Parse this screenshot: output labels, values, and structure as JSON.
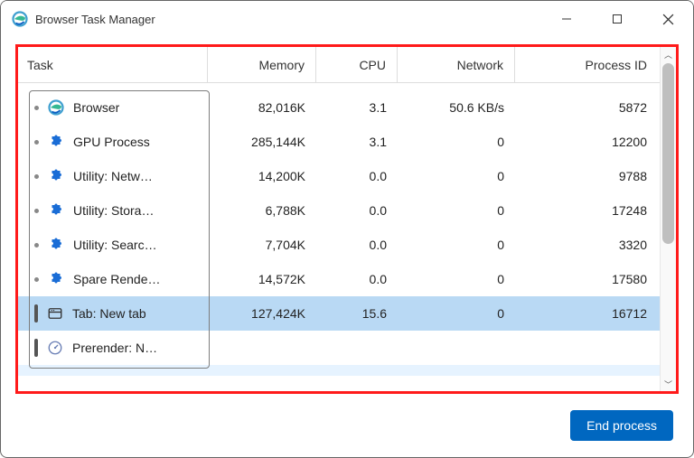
{
  "window": {
    "title": "Browser Task Manager"
  },
  "columns": {
    "task": "Task",
    "memory": "Memory",
    "cpu": "CPU",
    "network": "Network",
    "process_id": "Process ID"
  },
  "rows": [
    {
      "icon": "edge",
      "name": "Browser",
      "memory": "82,016K",
      "cpu": "3.1",
      "network": "50.6 KB/s",
      "pid": "5872",
      "selected": false,
      "handle": "bullet"
    },
    {
      "icon": "puzzle",
      "name": "GPU Process",
      "memory": "285,144K",
      "cpu": "3.1",
      "network": "0",
      "pid": "12200",
      "selected": false,
      "handle": "bullet"
    },
    {
      "icon": "puzzle",
      "name": "Utility: Netw…",
      "memory": "14,200K",
      "cpu": "0.0",
      "network": "0",
      "pid": "9788",
      "selected": false,
      "handle": "bullet"
    },
    {
      "icon": "puzzle",
      "name": "Utility: Stora…",
      "memory": "6,788K",
      "cpu": "0.0",
      "network": "0",
      "pid": "17248",
      "selected": false,
      "handle": "bullet"
    },
    {
      "icon": "puzzle",
      "name": "Utility: Searc…",
      "memory": "7,704K",
      "cpu": "0.0",
      "network": "0",
      "pid": "3320",
      "selected": false,
      "handle": "bullet"
    },
    {
      "icon": "puzzle",
      "name": "Spare Rende…",
      "memory": "14,572K",
      "cpu": "0.0",
      "network": "0",
      "pid": "17580",
      "selected": false,
      "handle": "bullet"
    },
    {
      "icon": "tab",
      "name": "Tab: New tab",
      "memory": "127,424K",
      "cpu": "15.6",
      "network": "0",
      "pid": "16712",
      "selected": true,
      "handle": "handle"
    },
    {
      "icon": "gauge",
      "name": "Prerender: N…",
      "memory": "",
      "cpu": "",
      "network": "",
      "pid": "",
      "selected": false,
      "handle": "handle"
    }
  ],
  "actions": {
    "end_process": "End process"
  }
}
